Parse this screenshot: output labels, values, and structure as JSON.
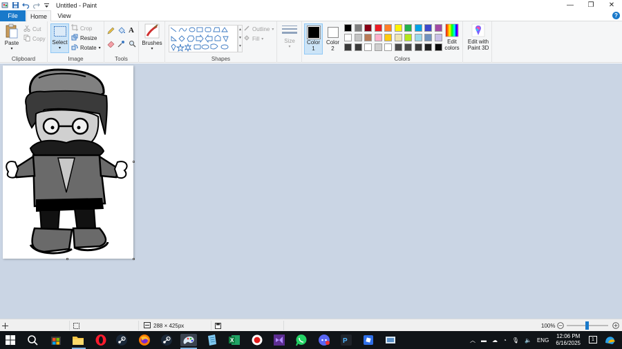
{
  "window": {
    "title": "Untitled - Paint",
    "controls": [
      "minimize-icon",
      "restore-icon",
      "close-icon"
    ]
  },
  "tabs": {
    "file": "File",
    "home": "Home",
    "view": "View"
  },
  "ribbon": {
    "clipboard": {
      "label": "Clipboard",
      "paste": "Paste",
      "cut": "Cut",
      "copy": "Copy"
    },
    "image": {
      "label": "Image",
      "select": "Select",
      "crop": "Crop",
      "resize": "Resize",
      "rotate": "Rotate"
    },
    "tools": {
      "label": "Tools"
    },
    "brushes": {
      "label": "Brushes"
    },
    "shapes": {
      "label": "Shapes",
      "outline": "Outline",
      "fill": "Fill"
    },
    "size": {
      "label": "Size"
    },
    "color1": {
      "label": "Color",
      "num": "1",
      "value": "#000000"
    },
    "color2": {
      "label": "Color",
      "num": "2",
      "value": "#ffffff"
    },
    "colors": {
      "label": "Colors",
      "edit_label_1": "Edit",
      "edit_label_2": "colors",
      "palette_row1": [
        "#000000",
        "#7f7f7f",
        "#880015",
        "#ed1c24",
        "#ff7f27",
        "#fff200",
        "#22b14c",
        "#00a2e8",
        "#3f48cc",
        "#a349a4"
      ],
      "palette_row2": [
        "#ffffff",
        "#c3c3c3",
        "#b97a57",
        "#ffaec9",
        "#ffc90e",
        "#efe4b0",
        "#b5e61d",
        "#99d9ea",
        "#7092be",
        "#c8bfe7"
      ],
      "palette_row3": [
        "#3a3a3a",
        "#3a3a3a",
        "#ffffff",
        "#cfcfcf",
        "#ffffff",
        "#4a4a4a",
        "#4a4a4a",
        "#3a3a3a",
        "#1f1f1f",
        "#0a0a0a"
      ]
    },
    "paint3d": {
      "line1": "Edit with",
      "line2": "Paint 3D"
    }
  },
  "status": {
    "size": "288 × 425px",
    "zoom": "100%"
  },
  "taskbar": {
    "time": "12:06 PM",
    "date": "6/16/2025",
    "lang": "ENG",
    "notifications": "1"
  }
}
